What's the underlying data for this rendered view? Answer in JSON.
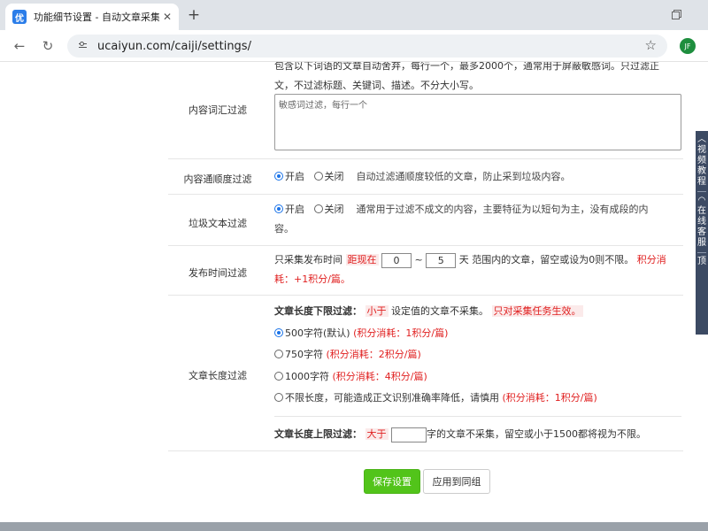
{
  "browser": {
    "tab_title": "功能细节设置 - 自动文章采集器",
    "favicon": "优",
    "url": "ucaiyun.com/caiji/settings/",
    "avatar_initials": "JF"
  },
  "form": {
    "keywords": {
      "desc_line1": "包含以下词语的文章自动舍弃，每行一个，最多2000个，通常用于屏蔽敏感词。只过滤正",
      "desc_line2": "文，不过滤标题、关键词、描述。不分大小写。",
      "label": "内容词汇过滤",
      "placeholder": "敏感词过滤，每行一个"
    },
    "fluency": {
      "label": "内容通顺度过滤",
      "on": "开启",
      "off": "关闭",
      "hint": "自动过滤通顺度较低的文章，防止采到垃圾内容。"
    },
    "spam": {
      "label": "垃圾文本过滤",
      "on": "开启",
      "off": "关闭",
      "hint_line1": "通常用于过滤不成文的内容，主要特征为以短句为主，没有成段的内",
      "hint_line2": "容。"
    },
    "time": {
      "label": "发布时间过滤",
      "prefix": "只采集发布时间",
      "dist": "距现在",
      "from": "0",
      "tilde": "~",
      "to": "5",
      "suffix": "天 范围内的文章，留空或设为0则不限。",
      "cost": "积分消",
      "cost2": "耗：+1积分/篇。"
    },
    "length": {
      "label": "文章长度过滤",
      "min_title": "文章长度下限过滤：",
      "min_lt": "小于",
      "min_mid": "设定值的文章不采集。",
      "min_note": "只对采集任务生效。",
      "opt1": "500字符(默认)",
      "opt1_cost": "(积分消耗：1积分/篇)",
      "opt2": "750字符",
      "opt2_cost": "(积分消耗：2积分/篇)",
      "opt3": "1000字符",
      "opt3_cost": "(积分消耗：4积分/篇)",
      "opt4": "不限长度，可能造成正文识别准确率降低，请慎用",
      "opt4_cost": "(积分消耗：1积分/篇)",
      "max_title": "文章长度上限过滤：",
      "max_gt": "大于",
      "max_suffix": "字的文章不采集，留空或小于1500都将视为不限。"
    },
    "buttons": {
      "save": "保存设置",
      "apply_group": "应用到同组"
    }
  },
  "side_panel": {
    "items": [
      "视",
      "频",
      "教",
      "程",
      "在",
      "线",
      "客",
      "服",
      "顶"
    ]
  }
}
